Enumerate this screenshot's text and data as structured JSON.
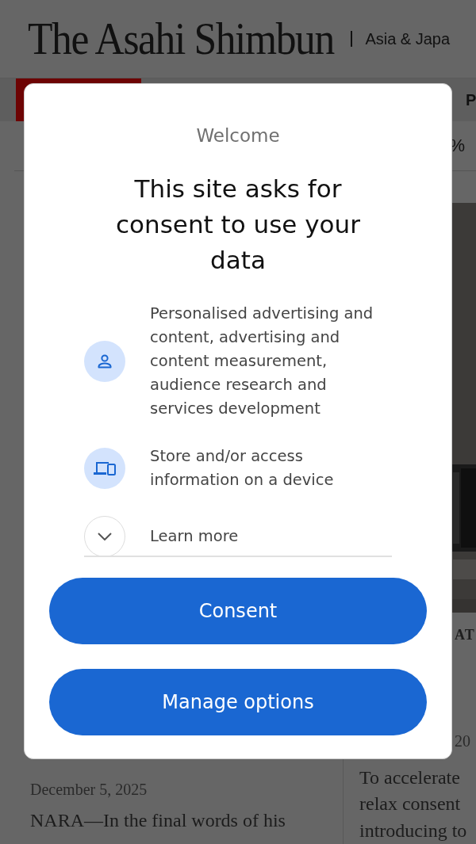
{
  "background_page": {
    "logo": "The Asahi Shimbun",
    "edition": "Asia & Japa",
    "nav_tab": "P",
    "ticker_right": "%",
    "left_article": {
      "date": "December 5, 2025",
      "summary": "NARA—In the final words of his"
    },
    "right_article": {
      "kind": "picture",
      "category": "AT",
      "date": "20",
      "summary_lines": [
        "To accelerate",
        "relax consent",
        "introducing to"
      ]
    }
  },
  "consent_dialog": {
    "welcome": "Welcome",
    "title": "This site asks for consent to use your data",
    "purposes": [
      {
        "kind": "person",
        "text": "Personalised advertising and content, advertising and content measurement, audience research and services development"
      },
      {
        "kind": "devices",
        "text": "Store and/or access information on a device"
      },
      {
        "kind": "expand",
        "text": "Learn more"
      }
    ],
    "buttons": [
      "Consent",
      "Manage options"
    ]
  }
}
